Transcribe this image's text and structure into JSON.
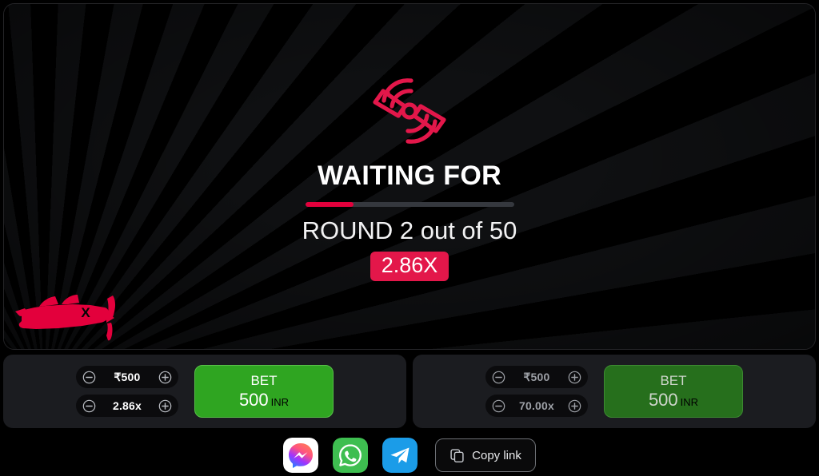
{
  "game": {
    "icon_name": "propeller-icon",
    "waiting_title": "WAITING FOR",
    "progress_percent": 23,
    "round_text": "ROUND 2 out of 50",
    "multiplier_badge": "2.86X",
    "plane_icon_name": "red-plane-icon",
    "plane_marking": "X",
    "accent_red": "#e3174a",
    "progress_red": "#e3003c"
  },
  "bet_panels": [
    {
      "amount_value": "₹500",
      "multiplier_value": "2.86x",
      "decrease_label": "minus-icon",
      "increase_label": "plus-icon",
      "button_label": "BET",
      "button_amount": "500",
      "button_currency": "INR",
      "state": "active"
    },
    {
      "amount_value": "₹500",
      "multiplier_value": "70.00x",
      "decrease_label": "minus-icon",
      "increase_label": "plus-icon",
      "button_label": "BET",
      "button_amount": "500",
      "button_currency": "INR",
      "state": "disabled"
    }
  ],
  "share": {
    "messenger_label": "messenger-icon",
    "whatsapp_label": "whatsapp-icon",
    "telegram_label": "telegram-icon",
    "copy_link_label": "Copy link"
  }
}
